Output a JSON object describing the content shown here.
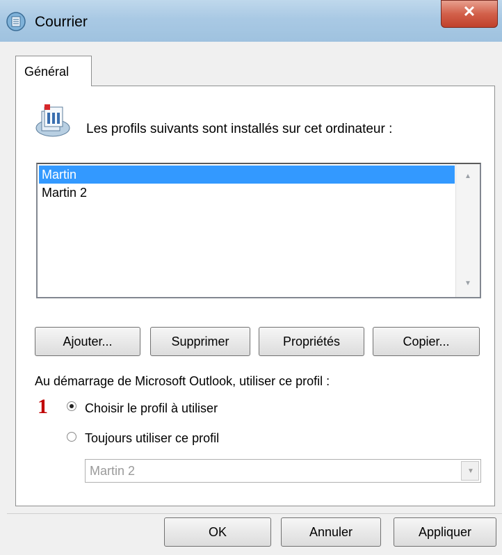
{
  "window": {
    "title": "Courrier"
  },
  "tabs": [
    {
      "label": "Général"
    }
  ],
  "intro": "Les profils suivants sont installés sur cet ordinateur :",
  "profiles": [
    {
      "name": "Martin",
      "selected": true
    },
    {
      "name": "Martin 2",
      "selected": false
    }
  ],
  "actions": {
    "add": "Ajouter...",
    "remove": "Supprimer",
    "properties": "Propriétés",
    "copy": "Copier..."
  },
  "startup": {
    "label": "Au démarrage de Microsoft Outlook, utiliser ce profil :",
    "annotation": "1",
    "option_choose": "Choisir le profil à utiliser",
    "option_always": "Toujours utiliser ce profil",
    "selected_option": "choose",
    "profile_select_value": "Martin 2"
  },
  "footer": {
    "ok": "OK",
    "cancel": "Annuler",
    "apply": "Appliquer"
  },
  "colors": {
    "selection": "#3399ff",
    "annotation": "#c00000",
    "close": "#c0412c"
  },
  "icons": {
    "title": "mail-profile-icon",
    "close": "close-icon",
    "large": "mail-profiles-icon"
  }
}
